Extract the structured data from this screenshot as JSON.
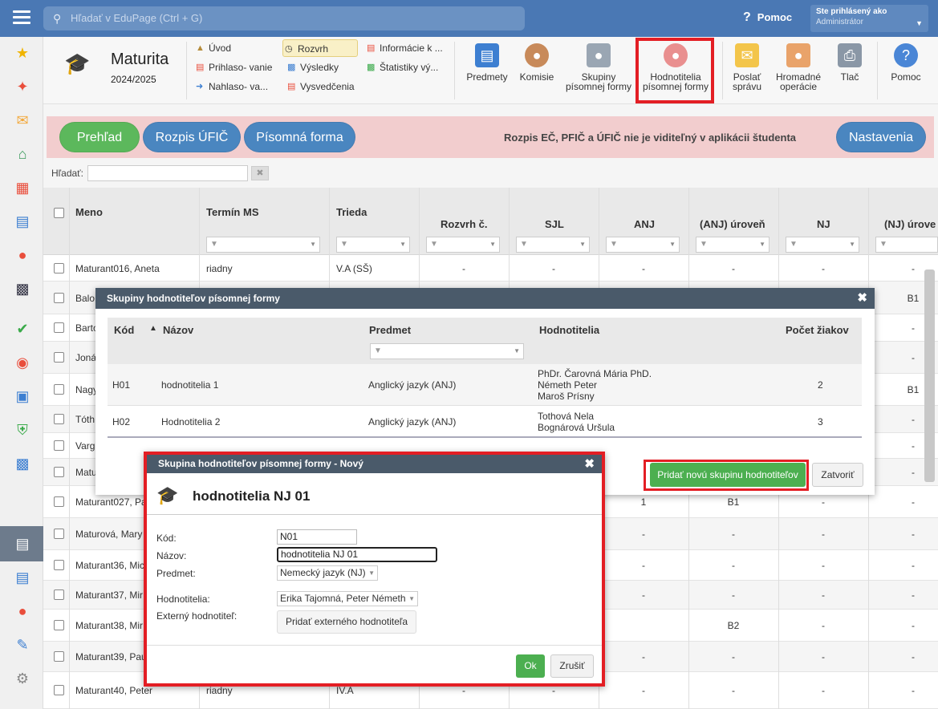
{
  "topbar": {
    "search_placeholder": "Hľadať v EduPage (Ctrl + G)",
    "help": "Pomoc",
    "user_line1": "Ste prihlásený ako",
    "user_line2": "Administrátor"
  },
  "module": {
    "title": "Maturita",
    "year": "2024/2025"
  },
  "menu": {
    "uvod": "Úvod",
    "prihlasovanie": "Prihlaso- vanie",
    "nahlasovanie": "Nahlaso- va...",
    "rozvrh": "Rozvrh",
    "vysledky": "Výsledky",
    "vysvedcenia": "Vysvedčenia",
    "informacie": "Informácie k ...",
    "statistiky": "Štatistiky vý..."
  },
  "toolbar": {
    "predmety": "Predmety",
    "komisie": "Komisie",
    "skupiny_l1": "Skupiny",
    "skupiny_l2": "písomnej formy",
    "hodnotitelia_l1": "Hodnotitelia",
    "hodnotitelia_l2": "písomnej formy",
    "poslat_l1": "Poslať",
    "poslat_l2": "správu",
    "hromadne_l1": "Hromadné",
    "hromadne_l2": "operácie",
    "tlac": "Tlač",
    "pomoc": "Pomoc"
  },
  "tabs": {
    "prehlad": "Prehľad",
    "rozpis": "Rozpis ÚFIČ",
    "pisomna": "Písomná forma",
    "nastavenia": "Nastavenia",
    "notice": "Rozpis EČ, PFIČ a ÚFIČ nie je viditeľný v aplikácii študenta"
  },
  "filter": {
    "label": "Hľadať:"
  },
  "grid": {
    "headers": {
      "meno": "Meno",
      "termin": "Termín MS",
      "trieda": "Trieda",
      "rozvrh": "Rozvrh č.",
      "sjl": "SJL",
      "anj": "ANJ",
      "anj_uroven": "(ANJ) úroveň",
      "nj": "NJ",
      "nj_uroven": "(NJ) úrove"
    },
    "rows": [
      {
        "meno": "Maturant016, Aneta",
        "termin": "riadny",
        "trieda": "V.A (SŠ)",
        "rozvrh": "-",
        "sjl": "-",
        "anj": "-",
        "anj_u": "-",
        "nj": "-",
        "nj_u": "-"
      },
      {
        "meno": "Balo",
        "nj_u": "B1"
      },
      {
        "meno": "Barto",
        "nj_u": "-"
      },
      {
        "meno": "Joná",
        "nj_u": "-"
      },
      {
        "meno": "Nagy",
        "nj_u": "B1"
      },
      {
        "meno": "Tóth",
        "nj_u": "-"
      },
      {
        "meno": "Varg",
        "nj_u": "-"
      },
      {
        "meno": "Matu",
        "nj_u": "-"
      },
      {
        "meno": "Maturant027, Pa",
        "anj": "1",
        "anj_u": "B1",
        "nj": "-",
        "nj_u": "-"
      },
      {
        "meno": "Maturová, Mary",
        "anj": "-",
        "anj_u": "-",
        "nj": "-",
        "nj_u": "-"
      },
      {
        "meno": "Maturant36, Mic",
        "anj": "-",
        "anj_u": "-",
        "nj": "-",
        "nj_u": "-"
      },
      {
        "meno": "Maturant37, Mir",
        "anj": "-",
        "anj_u": "-",
        "nj": "-",
        "nj_u": "-"
      },
      {
        "meno": "Maturant38, Mir",
        "anj": "",
        "anj_u": "B2",
        "nj": "-",
        "nj_u": "-"
      },
      {
        "meno": "Maturant39, Pau",
        "anj": "-",
        "anj_u": "-",
        "nj": "-",
        "nj_u": "-"
      },
      {
        "meno": "Maturant40, Peter",
        "termin": "riadny",
        "trieda": "IV.A",
        "rozvrh": "-",
        "sjl": "-",
        "anj": "-",
        "anj_u": "-",
        "nj": "-",
        "nj_u": "-"
      }
    ]
  },
  "groups_dialog": {
    "title": "Skupiny hodnotiteľov písomnej formy",
    "headers": {
      "kod": "Kód",
      "nazov": "Názov",
      "predmet": "Predmet",
      "hodnotitelia": "Hodnotitelia",
      "pocet": "Počet žiakov"
    },
    "rows": [
      {
        "kod": "H01",
        "nazov": "hodnotitelia 1",
        "predmet": "Anglický jazyk (ANJ)",
        "h1": "PhDr. Čarovná Mária PhD.",
        "h2": "Németh Peter",
        "h3": "Maroš Prísny",
        "pocet": "2"
      },
      {
        "kod": "H02",
        "nazov": "Hodnotitelia 2",
        "predmet": "Anglický jazyk (ANJ)",
        "h1": "Tothová Nela",
        "h2": "Bognárová Uršula",
        "pocet": "3"
      }
    ],
    "add_button": "Pridať novú skupinu hodnotiteľov",
    "close_button": "Zatvoriť"
  },
  "new_dialog": {
    "title": "Skupina hodnotiteľov písomnej formy - Nový",
    "heading": "hodnotitelia NJ 01",
    "labels": {
      "kod": "Kód:",
      "nazov": "Názov:",
      "predmet": "Predmet:",
      "hodnotitelia": "Hodnotitelia:",
      "externy": "Externý hodnotiteľ:"
    },
    "values": {
      "kod": "N01",
      "nazov": "hodnotitelia NJ 01",
      "predmet": "Nemecký jazyk (NJ)",
      "hodnotitelia": "Erika Tajomná, Peter Németh"
    },
    "add_external": "Pridať externého hodnotiteľa",
    "ok": "Ok",
    "cancel": "Zrušiť"
  },
  "colors": {
    "accent": "#4a78b4",
    "highlight": "#e31e24",
    "green": "#4caf50"
  }
}
